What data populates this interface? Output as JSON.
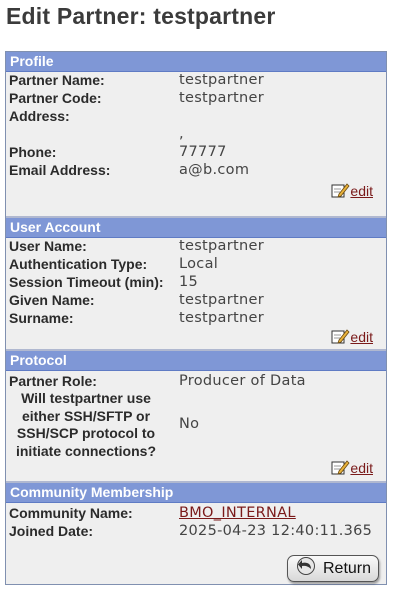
{
  "title": "Edit Partner: testpartner",
  "profile": {
    "header": "Profile",
    "partner_name_label": "Partner Name:",
    "partner_name": "testpartner",
    "partner_code_label": "Partner Code:",
    "partner_code": "testpartner",
    "address_label": "Address:",
    "address": ",",
    "phone_label": "Phone:",
    "phone": "77777",
    "email_label": "Email Address:",
    "email": "a@b.com",
    "edit": "edit"
  },
  "user_account": {
    "header": "User Account",
    "user_name_label": "User Name:",
    "user_name": "testpartner",
    "auth_type_label": "Authentication Type:",
    "auth_type": "Local",
    "timeout_label": "Session Timeout (min):",
    "timeout": "15",
    "given_name_label": "Given Name:",
    "given_name": "testpartner",
    "surname_label": "Surname:",
    "surname": "testpartner",
    "edit": "edit"
  },
  "protocol": {
    "header": "Protocol",
    "role_label": "Partner Role:",
    "role": "Producer of Data",
    "ssh_label_1": "Will testpartner use",
    "ssh_label_2": "either SSH/SFTP or",
    "ssh_label_3": "SSH/SCP protocol to",
    "ssh_label_4": "initiate connections?",
    "ssh_value": "No",
    "edit": "edit"
  },
  "community": {
    "header": "Community Membership",
    "name_label": "Community Name:",
    "name": "BMO_INTERNAL",
    "joined_label": "Joined Date:",
    "joined": "2025-04-23 12:40:11.365"
  },
  "return_button": "Return",
  "icons": {
    "edit": "edit-pencil-icon",
    "return": "return-arrow-icon"
  }
}
